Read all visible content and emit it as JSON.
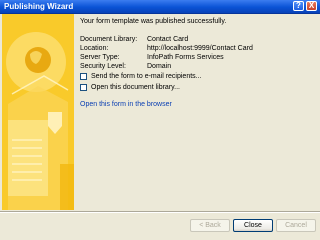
{
  "window": {
    "title": "Publishing Wizard",
    "help_glyph": "?",
    "close_glyph": "X"
  },
  "main": {
    "message": "Your form template was published successfully.",
    "details": [
      {
        "label": "Document Library:",
        "value": "Contact Card"
      },
      {
        "label": "Location:",
        "value": "http://localhost:9999/Contact Card"
      },
      {
        "label": "Server Type:",
        "value": "InfoPath Forms Services"
      },
      {
        "label": "Security Level:",
        "value": "Domain"
      }
    ],
    "checkboxes": [
      {
        "label": "Send the form to e-mail recipients...",
        "checked": false
      },
      {
        "label": "Open this document library...",
        "checked": false
      }
    ],
    "open_link": "Open this form in the browser"
  },
  "buttons": {
    "back": "< Back",
    "close": "Close",
    "cancel": "Cancel"
  },
  "colors": {
    "title_bar": "#0a53d6",
    "side_art_yellow": "#f6c21a",
    "link": "#0a3fb3"
  }
}
